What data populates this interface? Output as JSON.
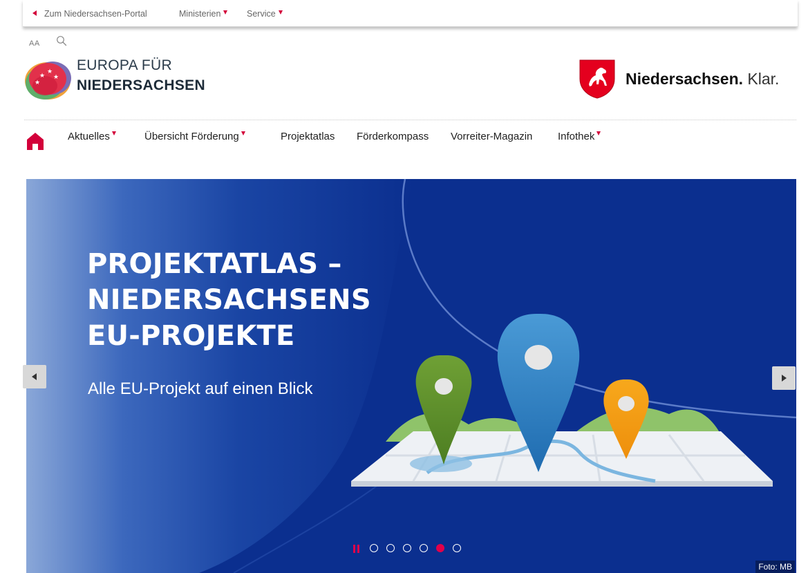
{
  "topbar": {
    "portal_link": "Zum Niedersachsen-Portal",
    "ministerien": "Ministerien",
    "service": "Service"
  },
  "tools": {
    "font_size_toggle": "AA",
    "search_icon": "search-icon"
  },
  "brand": {
    "line1": "EUROPA FÜR",
    "line2": "NIEDERSACHSEN"
  },
  "state_logo": {
    "name": "Niedersachsen.",
    "slogan": "Klar."
  },
  "nav": {
    "home_icon": "home-icon",
    "items": [
      {
        "label": "Aktuelles",
        "has_dropdown": true
      },
      {
        "label": "Übersicht Förderung",
        "has_dropdown": true
      },
      {
        "label": "Projektatlas",
        "has_dropdown": false
      },
      {
        "label": "Förderkompass",
        "has_dropdown": false
      },
      {
        "label": "Vorreiter-Magazin",
        "has_dropdown": false
      },
      {
        "label": "Infothek",
        "has_dropdown": true
      }
    ]
  },
  "hero": {
    "title_lines": [
      "PROJEKTATLAS –",
      "NIEDERSACHSENS",
      "EU-PROJEKTE"
    ],
    "subtitle": "Alle EU-Projekt auf einen Blick",
    "photo_credit": "Foto: MB",
    "slide_count": 6,
    "active_slide": 5
  },
  "colors": {
    "accent_red": "#d3003a",
    "hero_blue": "#0b2f8f",
    "pin_green": "#5a8a2a",
    "pin_blue": "#2a7fc0",
    "pin_orange": "#f39a12"
  }
}
